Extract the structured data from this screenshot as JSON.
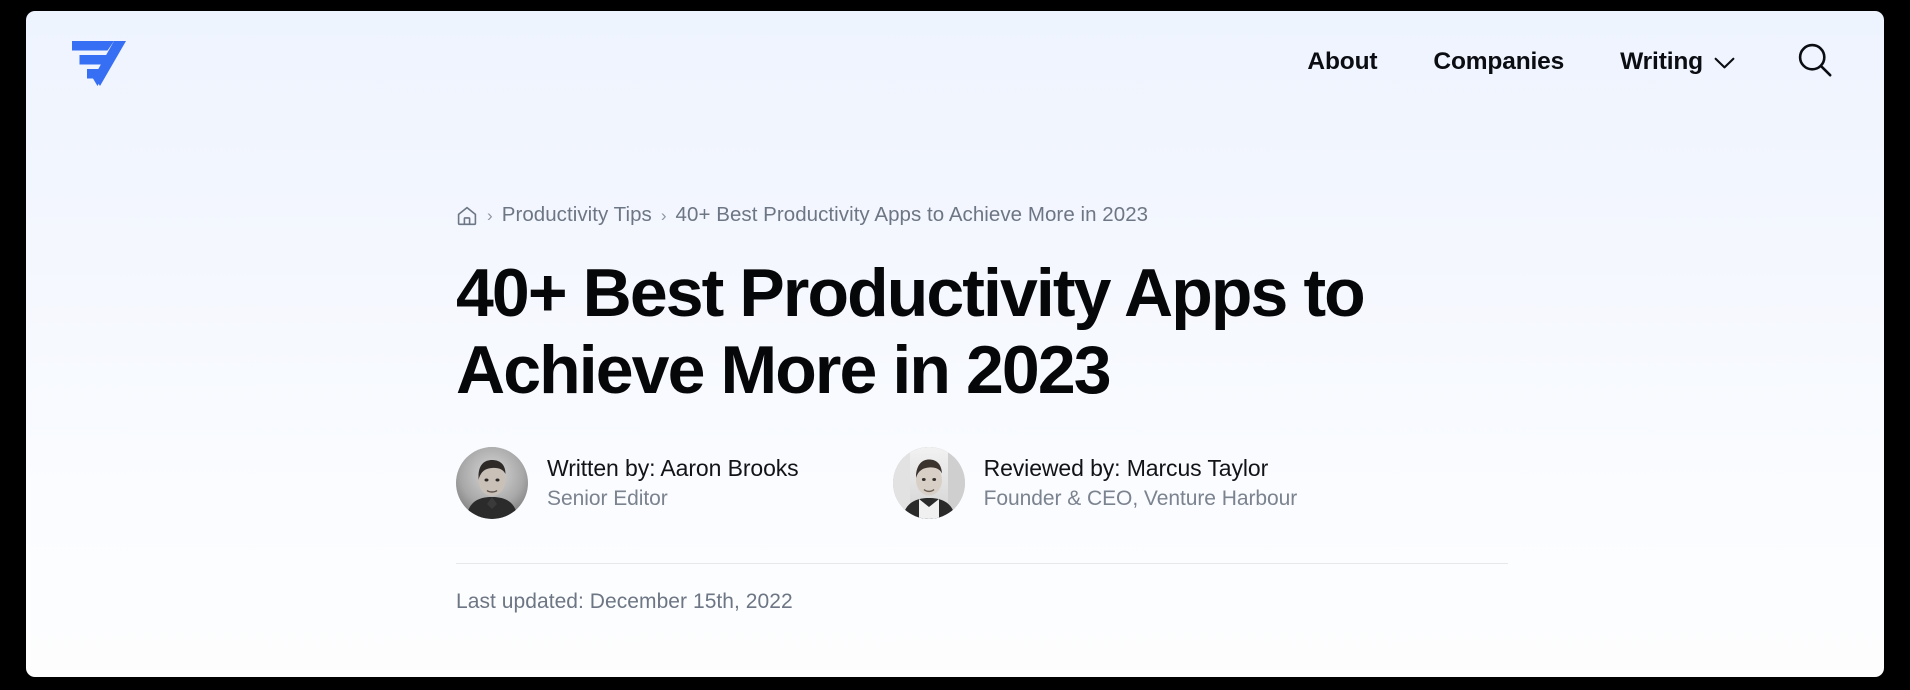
{
  "brand": {
    "logo_icon": "venture-harbour-wing-logo",
    "accent_color": "#366ef4"
  },
  "header": {
    "nav": [
      {
        "label": "About",
        "icon": null
      },
      {
        "label": "Companies",
        "icon": null
      },
      {
        "label": "Writing",
        "icon": "chevron-down-icon"
      }
    ],
    "search_icon": "search-icon"
  },
  "breadcrumb": {
    "home_icon": "home-icon",
    "separator": "›",
    "items": [
      {
        "label": "Productivity Tips",
        "current": false
      },
      {
        "label": "40+ Best Productivity Apps to Achieve More in 2023",
        "current": true
      }
    ]
  },
  "article": {
    "title": "40+ Best Productivity Apps to Achieve More in 2023",
    "contributors": [
      {
        "name": "Written by: Aaron Brooks",
        "role": "Senior Editor",
        "avatar": "portrait-aaron-brooks"
      },
      {
        "name": "Reviewed by: Marcus Taylor",
        "role": "Founder & CEO, Venture Harbour",
        "avatar": "portrait-marcus-taylor"
      }
    ],
    "last_updated": "Last updated: December 15th, 2022"
  },
  "colors": {
    "background_top": "#eef4fe",
    "background_bottom": "#fdfdfe",
    "text_primary": "#0b0d12",
    "text_muted": "#6d7684",
    "divider": "#e6e8ec"
  }
}
